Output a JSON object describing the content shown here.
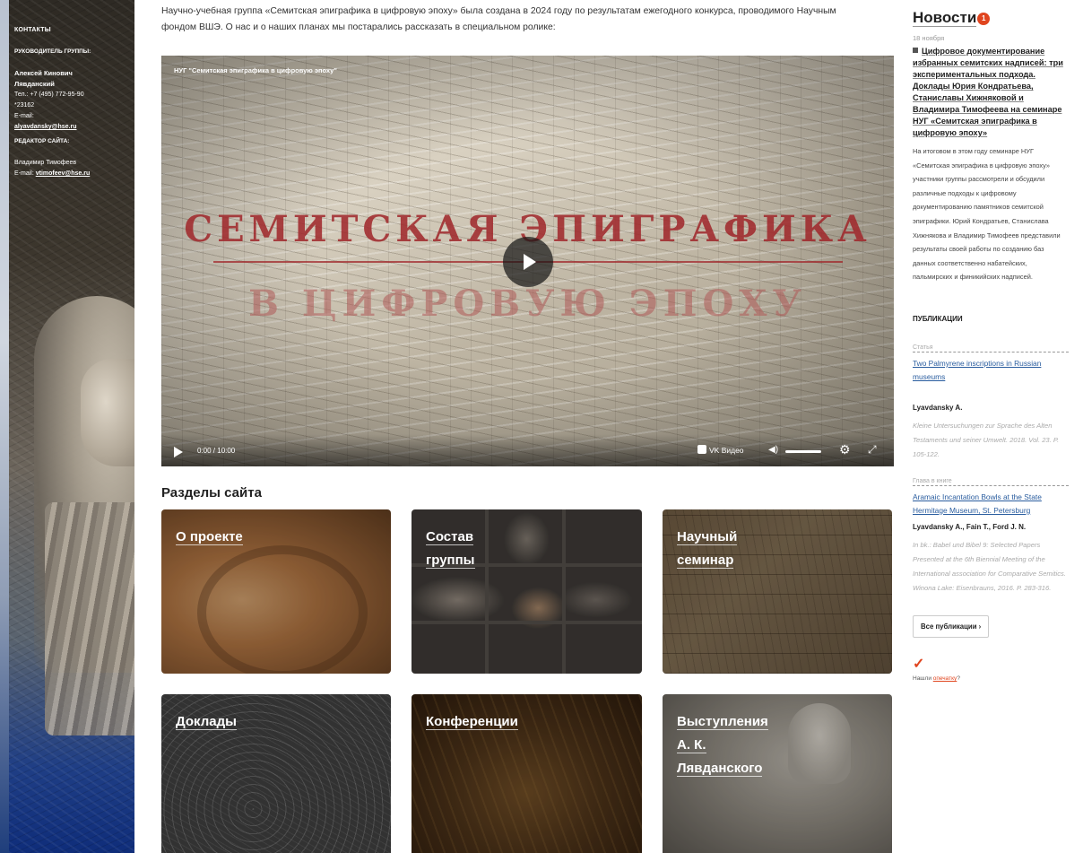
{
  "sidebar": {
    "contacts_heading": "КОНТАКТЫ",
    "head_label": "РУКОВОДИТЕЛЬ ГРУППЫ:",
    "head_name_1": "Алексей Кинович",
    "head_name_2": "Лявданский",
    "phone": "Тел.: +7 (495) 772-95-90",
    "ext": "*23162",
    "email_label": "E-mail:",
    "head_email": "alyavdansky@hse.ru",
    "editor_label": "РЕДАКТОР САЙТА:",
    "editor_name": "Владимир Тимофеев",
    "editor_email_label": "E-mail:",
    "editor_email": "vtimofeev@hse.ru"
  },
  "main": {
    "intro": "Научно-учебная группа «Семитская эпиграфика в цифровую эпоху» была создана в 2024 году по результатам ежегодного конкурса, проводимого Научным фондом ВШЭ. О нас и о наших планах мы постарались рассказать в специальном ролике:",
    "video": {
      "title": "НУГ \"Семитская эпиграфика в цифровую эпоху\"",
      "line1": "СЕМИТСКАЯ ЭПИГРАФИКА",
      "line2": "В ЦИФРОВУЮ ЭПОХУ",
      "time": "0:00 / 10:00",
      "brand": "VK Видео",
      "progress": 0
    },
    "sections_title": "Разделы сайта",
    "tiles": [
      {
        "l1": "О проекте",
        "l2": "",
        "l3": ""
      },
      {
        "l1": "Состав",
        "l2": "группы",
        "l3": ""
      },
      {
        "l1": "Научный",
        "l2": "семинар",
        "l3": ""
      },
      {
        "l1": "Доклады",
        "l2": "",
        "l3": ""
      },
      {
        "l1": "Конференции",
        "l2": "",
        "l3": ""
      },
      {
        "l1": "Выступления",
        "l2": "А. К.",
        "l3": "Лявданского"
      }
    ]
  },
  "news": {
    "title": "Новости",
    "badge": "1",
    "date": "18 ноября",
    "headline": "Цифровое документирование избранных семитских надписей: три экспериментальных подхода. Доклады Юрия Кондратьева, Станиславы Хижняковой и Владимира Тимофеева на семинаре НУГ «Семитская эпиграфика в цифровую эпоху»",
    "text": "На итоговом в этом году семинаре НУГ «Семитская эпиграфика в цифровую эпоху» участники группы рассмотрели и обсудили различные подходы к цифровому документированию памятников семитской эпиграфики. Юрий Кондратьев, Станислава Хижнякова и Владимир Тимофеев представили результаты своей работы по созданию баз данных соответственно набатейских, пальмирских и финикийских надписей."
  },
  "publications": {
    "heading": "ПУБЛИКАЦИИ",
    "items": [
      {
        "type": "Статья",
        "title": "Two Palmyrene inscriptions in Russian museums",
        "author": "Lyavdansky A.",
        "source": "Kleine Untersuchungen zur Sprache des Alten Testaments und seiner Umwelt. 2018. Vol. 23. P. 105-122."
      },
      {
        "type": "Глава в книге",
        "title": "Aramaic Incantation Bowls at the State Hermitage Museum, St. Petersburg",
        "author": "Lyavdansky A., Fain T., Ford J. N.",
        "source": "In bk.: Babel und Bibel 9: Selected Papers Presented at the 6th Biennial Meeting of the International association for Comparative Semitics. Winona Lake: Eisenbrauns, 2016. P. 283-316."
      }
    ],
    "all_button": "Все публикации ›"
  },
  "typo": {
    "prefix": "Нашли ",
    "link": "опечатку",
    "suffix": "?"
  },
  "colors": {
    "accent": "#e0451f",
    "link": "#2a5d9f",
    "video_text": "#a0262a"
  }
}
